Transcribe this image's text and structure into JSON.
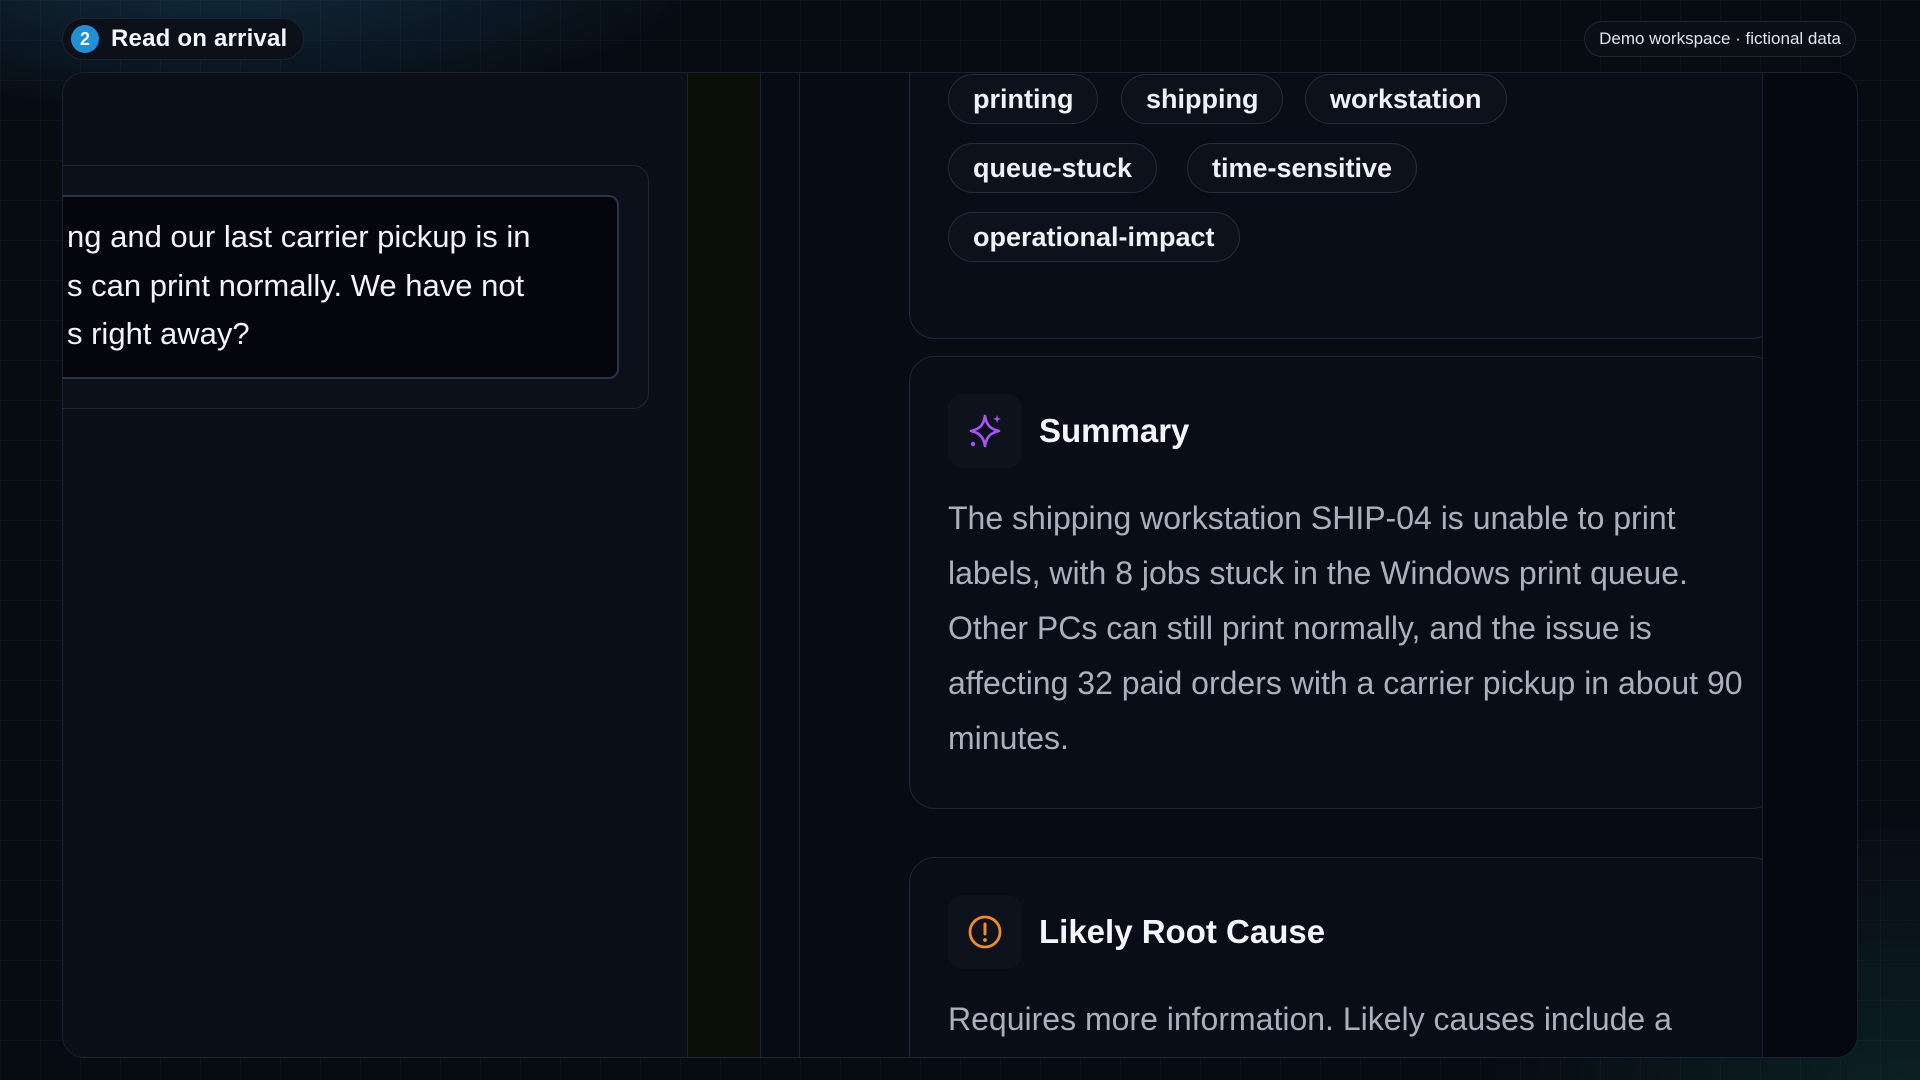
{
  "header": {
    "step_number": "2",
    "step_label": "Read on arrival",
    "workspace_badge": "Demo workspace · fictional data"
  },
  "message": {
    "lines": [
      "ng and our last carrier pickup is in",
      "s can print normally. We have not",
      "s right away?"
    ]
  },
  "tags": [
    "printing",
    "shipping",
    "workstation",
    "queue-stuck",
    "time-sensitive",
    "operational-impact"
  ],
  "summary": {
    "title": "Summary",
    "icon": "sparkle-icon",
    "icon_color": "#a855f7",
    "body": "The shipping workstation SHIP-04 is unable to print labels, with 8 jobs stuck in the Windows print queue. Other PCs can still print normally, and the issue is affecting 32 paid orders with a carrier pickup in about 90 minutes."
  },
  "root_cause": {
    "title": "Likely Root Cause",
    "icon": "alert-circle-icon",
    "icon_color": "#f28c28",
    "body": "Requires more information. Likely causes include a"
  },
  "colors": {
    "accent": "#1f8fd6"
  }
}
